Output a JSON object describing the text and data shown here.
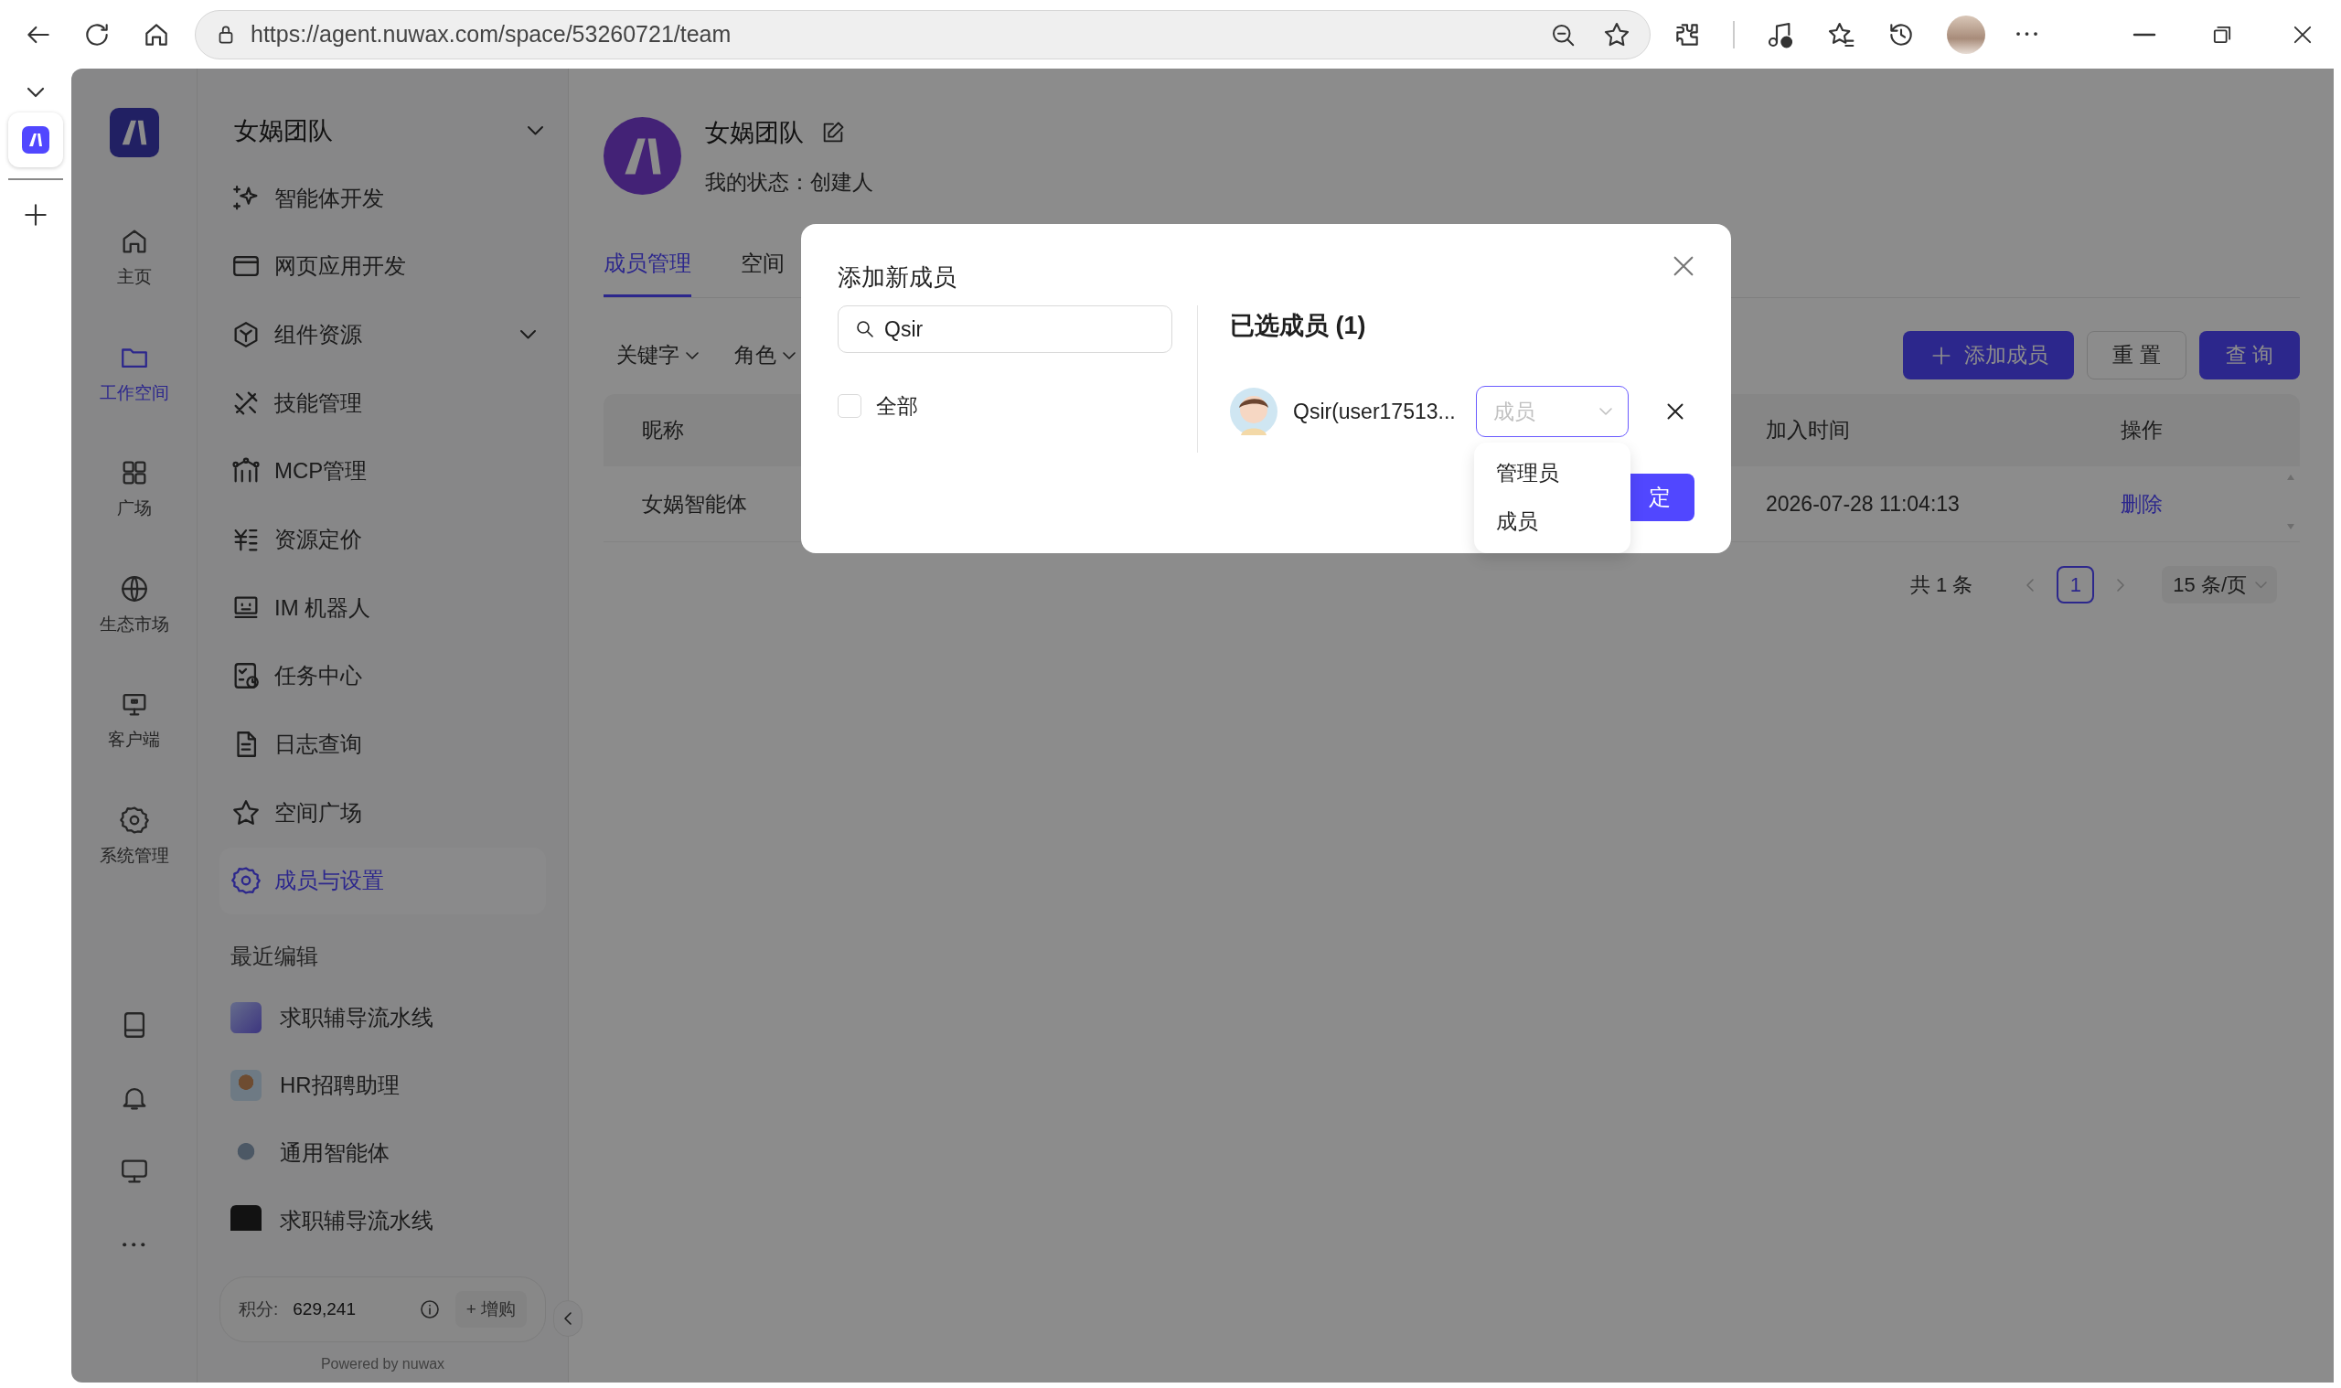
{
  "browser": {
    "address": "https://agent.nuwax.com/space/53260721/team"
  },
  "app_rail": {
    "items": [
      {
        "label": "主页",
        "kind": "home",
        "selected": false
      },
      {
        "label": "工作空间",
        "kind": "folder",
        "selected": true
      },
      {
        "label": "广场",
        "kind": "grid",
        "selected": false
      },
      {
        "label": "生态市场",
        "kind": "globe",
        "selected": false
      },
      {
        "label": "客户端",
        "kind": "client",
        "selected": false
      },
      {
        "label": "系统管理",
        "kind": "gear",
        "selected": false
      }
    ]
  },
  "sidebar": {
    "team_name": "女娲团队",
    "menu": [
      {
        "label": "智能体开发",
        "kind": "sparkle",
        "selected": false,
        "expandable": false
      },
      {
        "label": "网页应用开发",
        "kind": "window",
        "selected": false,
        "expandable": false
      },
      {
        "label": "组件资源",
        "kind": "cube",
        "selected": false,
        "expandable": true
      },
      {
        "label": "技能管理",
        "kind": "tools",
        "selected": false,
        "expandable": false
      },
      {
        "label": "MCP管理",
        "kind": "mcp",
        "selected": false,
        "expandable": false
      },
      {
        "label": "资源定价",
        "kind": "price",
        "selected": false,
        "expandable": false
      },
      {
        "label": "IM 机器人",
        "kind": "robot",
        "selected": false,
        "expandable": false
      },
      {
        "label": "任务中心",
        "kind": "task",
        "selected": false,
        "expandable": false
      },
      {
        "label": "日志查询",
        "kind": "doc",
        "selected": false,
        "expandable": false
      },
      {
        "label": "空间广场",
        "kind": "star",
        "selected": false,
        "expandable": false
      },
      {
        "label": "成员与设置",
        "kind": "gear",
        "selected": true,
        "expandable": false
      }
    ],
    "recent_title": "最近编辑",
    "recent": [
      {
        "label": "求职辅导流水线",
        "kind": "screen"
      },
      {
        "label": "HR招聘助理",
        "kind": "person"
      },
      {
        "label": "通用智能体",
        "kind": "robot"
      },
      {
        "label": "求职辅导流水线",
        "kind": "dark"
      }
    ],
    "points": {
      "label": "积分:",
      "value": "629,241",
      "buy": "+ 增购"
    },
    "footer": "Powered by nuwax"
  },
  "header": {
    "title": "女娲团队",
    "status": "我的状态：创建人"
  },
  "tabs": [
    {
      "label": "成员管理",
      "selected": true
    },
    {
      "label": "空间",
      "selected": false
    }
  ],
  "filters": [
    {
      "label": "关键字"
    },
    {
      "label": "角色"
    }
  ],
  "actions": [
    {
      "label": "添加成员",
      "kind": "add"
    },
    {
      "label": "重 置",
      "kind": "default"
    },
    {
      "label": "查 询",
      "kind": "primary"
    }
  ],
  "table": {
    "columns": [
      "昵称",
      "加入时间",
      "操作"
    ],
    "rows": [
      {
        "cells": [
          "女娲智能体",
          "2026-07-28 11:04:13",
          "删除"
        ]
      }
    ]
  },
  "pagination": {
    "total": "共 1 条",
    "pages": [
      {
        "label": "1",
        "selected": true
      }
    ],
    "page_size": "15 条/页"
  },
  "dialog": {
    "title": "添加新成员",
    "search": {
      "value": "Qsir"
    },
    "select_all": {
      "label": "全部",
      "checked": false
    },
    "selected_title": "已选成员 (1)",
    "members": [
      {
        "name": "Qsir(user17513...",
        "role_placeholder": "成员"
      }
    ],
    "role_options": [
      {
        "label": "管理员",
        "selected": false
      },
      {
        "label": "成员",
        "selected": false
      }
    ],
    "confirm": "定"
  }
}
